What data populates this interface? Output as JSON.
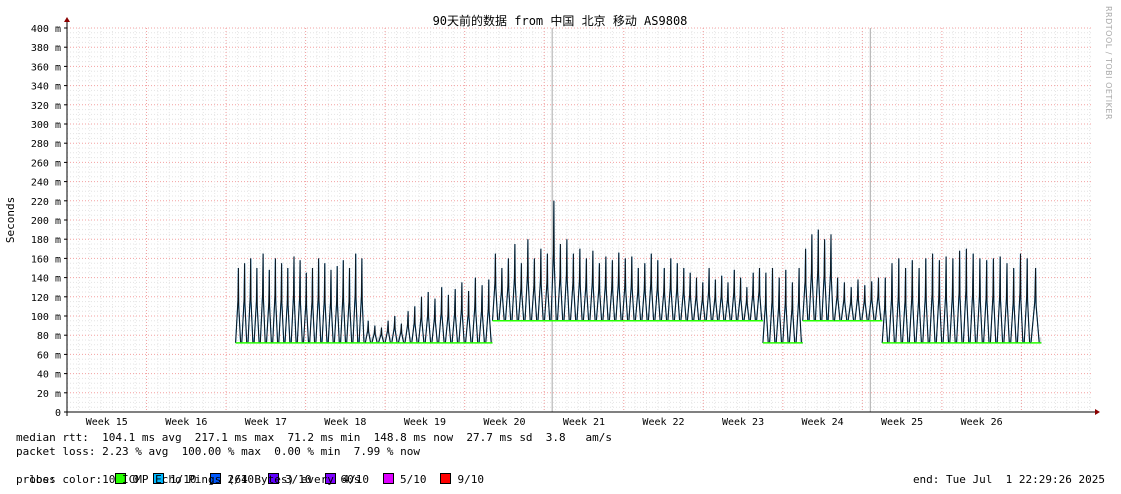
{
  "chart_data": {
    "type": "line",
    "title": "90天前的数据 from 中国 北京 移动 AS9808",
    "ylabel": "Seconds",
    "y_unit_suffix": "m",
    "ylim": [
      0,
      0.4
    ],
    "y_ticks": [
      "0",
      "20 m",
      "40 m",
      "60 m",
      "80 m",
      "100 m",
      "120 m",
      "140 m",
      "160 m",
      "180 m",
      "200 m",
      "220 m",
      "240 m",
      "260 m",
      "280 m",
      "300 m",
      "320 m",
      "340 m",
      "360 m",
      "380 m",
      "400 m"
    ],
    "x_ticks": [
      "Week 15",
      "Week 16",
      "Week 17",
      "Week 18",
      "Week 19",
      "Week 20",
      "Week 21",
      "Week 22",
      "Week 23",
      "Week 24",
      "Week 25",
      "Week 26"
    ],
    "grid": true,
    "series": [
      {
        "name": "median rtt",
        "segments": [
          {
            "from_week": 16.62,
            "to_week": 18.25,
            "base_ms": 72,
            "peak_ms": [
              150,
              155,
              160,
              150,
              165,
              148,
              160,
              155,
              150,
              162,
              158,
              145,
              150,
              160,
              155,
              148,
              152,
              158,
              150,
              165,
              160
            ]
          },
          {
            "from_week": 18.25,
            "to_week": 18.75,
            "base_ms": 72,
            "peak_ms": [
              95,
              90,
              88,
              95,
              100,
              92
            ]
          },
          {
            "from_week": 18.75,
            "to_week": 19.85,
            "base_ms": 72,
            "peak_ms": [
              105,
              110,
              120,
              125,
              118,
              130,
              122,
              128,
              135,
              126,
              140,
              132,
              138
            ]
          },
          {
            "from_week": 19.85,
            "to_week": 22.3,
            "base_ms": 95,
            "peak_ms": [
              165,
              150,
              160,
              175,
              155,
              180,
              160,
              170,
              165,
              220,
              175,
              180,
              165,
              170,
              160,
              168,
              155,
              162,
              158,
              166,
              160,
              162,
              150,
              155,
              165,
              158,
              150,
              160,
              155,
              150
            ]
          },
          {
            "from_week": 22.3,
            "to_week": 23.25,
            "base_ms": 95,
            "peak_ms": [
              145,
              140,
              135,
              150,
              138,
              142,
              135,
              148,
              140,
              130,
              145,
              150
            ]
          },
          {
            "from_week": 23.25,
            "to_week": 23.75,
            "base_ms": 72,
            "peak_ms": [
              145,
              150,
              140,
              148,
              135,
              150
            ]
          },
          {
            "from_week": 23.75,
            "to_week": 24.15,
            "base_ms": 95,
            "peak_ms": [
              170,
              185,
              190,
              180,
              185
            ]
          },
          {
            "from_week": 24.15,
            "to_week": 24.75,
            "base_ms": 95,
            "peak_ms": [
              140,
              135,
              130,
              138,
              132,
              136,
              140
            ]
          },
          {
            "from_week": 24.75,
            "to_week": 26.62,
            "base_ms": 72,
            "peak_ms": [
              140,
              155,
              160,
              150,
              158,
              150,
              160,
              165,
              158,
              162,
              160,
              168,
              170,
              165,
              160,
              158,
              160,
              162,
              155,
              150,
              165,
              160
            ]
          },
          {
            "from_week": 26.62,
            "to_week": 26.75,
            "base_ms": 72,
            "peak_ms": [
              150
            ]
          }
        ]
      }
    ],
    "vertical_rules_weeks": [
      20.6,
      24.6
    ]
  },
  "stats": {
    "median_rtt": "median rtt:  104.1 ms avg  217.1 ms max  71.2 ms min  148.8 ms now  27.7 ms sd  3.8   am/s",
    "packet_loss": "packet loss: 2.23 % avg  100.00 % max  0.00 % min  7.99 % now",
    "loss_color_label": "loss color:",
    "probe": "probe:       10 ICMP Echo Pings (64 Bytes) every 60s",
    "end": "end: Tue Jul  1 22:29:26 2025"
  },
  "loss_colors": [
    {
      "label": "0",
      "color": "#26ff00"
    },
    {
      "label": "1/10",
      "color": "#00b8ff"
    },
    {
      "label": "2/10",
      "color": "#0059ff"
    },
    {
      "label": "3/10",
      "color": "#5e00ff"
    },
    {
      "label": "4/10",
      "color": "#7e00ff"
    },
    {
      "label": "5/10",
      "color": "#dd00ff"
    },
    {
      "label": "9/10",
      "color": "#ff0000"
    }
  ],
  "watermark": "RRDTOOL / TOBI OETIKER"
}
